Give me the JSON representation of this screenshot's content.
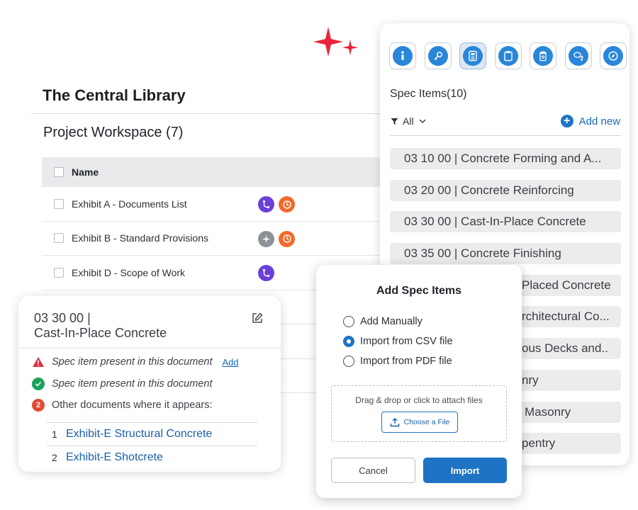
{
  "colors": {
    "accent": "#1f73c4",
    "sparkle": "#e8243a",
    "purple": "#6b3fd8",
    "orange": "#f26a2b",
    "green": "#18a35a",
    "red": "#e24b34"
  },
  "library": {
    "title": "The Central Library"
  },
  "workspace": {
    "title": "Project Workspace (7)",
    "table": {
      "header": "Name",
      "rows": [
        {
          "name": "Exhibit A - Documents List",
          "icons": [
            "branch-icon",
            "clock-icon"
          ]
        },
        {
          "name": "Exhibit B - Standard Provisions",
          "icons": [
            "sparkle-icon",
            "clock-icon"
          ]
        },
        {
          "name": "Exhibit D - Scope of Work",
          "icons": [
            "branch-icon"
          ]
        }
      ]
    }
  },
  "spec_panel": {
    "toolbar": [
      "info-icon",
      "key-icon",
      "document-icon",
      "clipboard-icon",
      "trash-icon",
      "chat-icon",
      "compass-icon"
    ],
    "heading": "Spec Items(10)",
    "filter": "All",
    "add_new": "Add new",
    "items": [
      "03 10 00 | Concrete Forming and A...",
      "03 20 00 | Concrete Reinforcing",
      "03 30 00 | Cast-In-Place Concrete",
      "03 35 00 | Concrete Finishing",
      "Placed Concrete",
      "rchitectural Co...",
      "ous Decks and..",
      "nry",
      "Masonry",
      "pentry"
    ]
  },
  "detail_card": {
    "code": "03 30 00 |",
    "title": "Cast-In-Place Concrete",
    "warning_text": "Spec item present in this document",
    "add_link": "Add",
    "success_text": "Spec item present in this document",
    "other_count": "2",
    "other_text": "Other documents where it appears:",
    "documents": [
      {
        "num": "1",
        "name": "Exhibit-E Structural Concrete"
      },
      {
        "num": "2",
        "name": "Exhibit-E Shotcrete"
      }
    ]
  },
  "modal": {
    "title": "Add Spec Items",
    "options": [
      "Add Manually",
      "Import from CSV file",
      "Import from PDF file"
    ],
    "selected": "Import from CSV file",
    "drop_text": "Drag & drop or click to attach files",
    "choose_label": "Choose a File",
    "cancel_label": "Cancel",
    "import_label": "Import"
  }
}
